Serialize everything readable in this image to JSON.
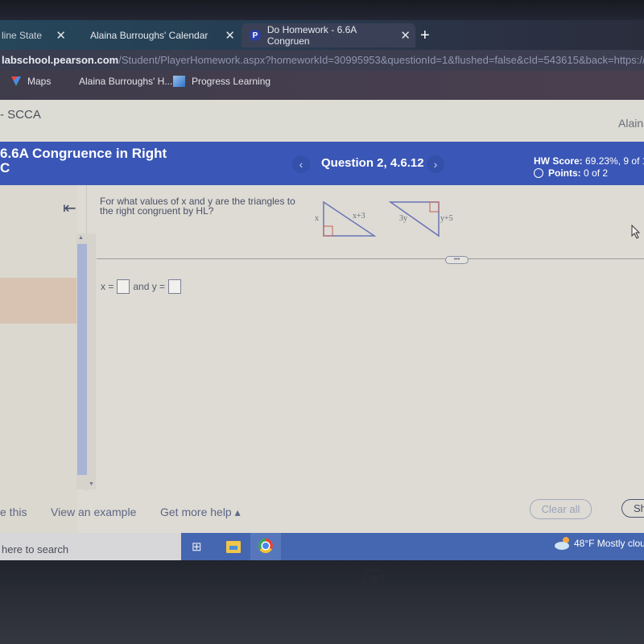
{
  "browser": {
    "tabs": [
      {
        "label": "line State",
        "close": "✕"
      },
      {
        "label": "Alaina Burroughs' Calendar",
        "close": "✕"
      },
      {
        "label": "Do Homework - 6.6A Congruen",
        "close": "✕",
        "icon": "pearson-p-icon",
        "icon_glyph": "P",
        "active": true
      }
    ],
    "new_tab": "+",
    "url_host": "labschool.pearson.com",
    "url_path": "/Student/PlayerHomework.aspx?homeworkId=30995953&questionId=1&flushed=false&cId=543615&back=https://mylab",
    "bookmarks": [
      {
        "label": "Maps",
        "icon": "maps-icon"
      },
      {
        "label": "Alaina Burroughs' H...",
        "icon": null
      },
      {
        "label": "Progress Learning",
        "icon": "progress-learning-icon"
      }
    ]
  },
  "page": {
    "course": "- SCCA",
    "user": "Alaina",
    "header": {
      "title_line1": "6.6A Congruence in Right",
      "title_line2": "C",
      "question_label": "Question 2, 4.6.12",
      "prev": "‹",
      "next": "›",
      "hw_score_label": "HW Score:",
      "hw_score_value": "69.23%, 9 of 1",
      "points_label": "Points:",
      "points_value": "0 of 2"
    },
    "collapse_icon": "⇤",
    "question_text": "For what values of x and y are the triangles to the right congruent by HL?",
    "figure": {
      "triangle1": {
        "leg": "x",
        "hypotenuse": "x+3"
      },
      "triangle2": {
        "hypotenuse": "3y",
        "leg": "y+5"
      },
      "line_color": "#6b74b8",
      "right_angle_color": "#c4605a"
    },
    "more_button": "•••",
    "answer": {
      "x_label": "x =",
      "x_value": "",
      "joiner": "and y =",
      "y_value": ""
    },
    "bottom": {
      "help_solve": "e this",
      "view_example": "View an example",
      "get_more_help": "Get more help ▴",
      "clear_all": "Clear all",
      "show": "Sh"
    }
  },
  "taskbar": {
    "search_placeholder": "here to search",
    "weather": "48°F  Mostly clou",
    "task_view_glyph": "⊞"
  },
  "bezel": {
    "logo": "hp"
  }
}
